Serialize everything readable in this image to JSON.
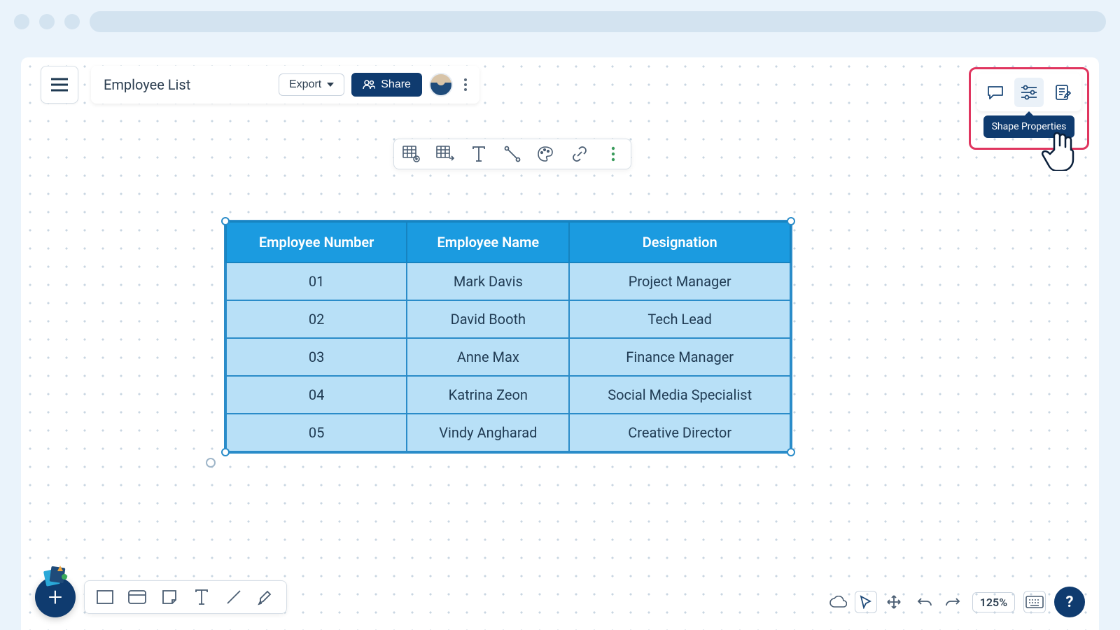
{
  "document": {
    "title": "Employee List",
    "export_label": "Export",
    "share_label": "Share"
  },
  "tooltip": {
    "shape_properties": "Shape Properties"
  },
  "table": {
    "headers": [
      "Employee Number",
      "Employee Name",
      "Designation"
    ],
    "rows": [
      {
        "num": "01",
        "name": "Mark Davis",
        "role": "Project Manager"
      },
      {
        "num": "02",
        "name": "David Booth",
        "role": "Tech Lead"
      },
      {
        "num": "03",
        "name": "Anne Max",
        "role": "Finance Manager"
      },
      {
        "num": "04",
        "name": "Katrina Zeon",
        "role": "Social Media Specialist"
      },
      {
        "num": "05",
        "name": "Vindy Angharad",
        "role": "Creative Director"
      }
    ]
  },
  "status": {
    "zoom": "125%",
    "help": "?"
  },
  "fab": {
    "plus": "+"
  }
}
